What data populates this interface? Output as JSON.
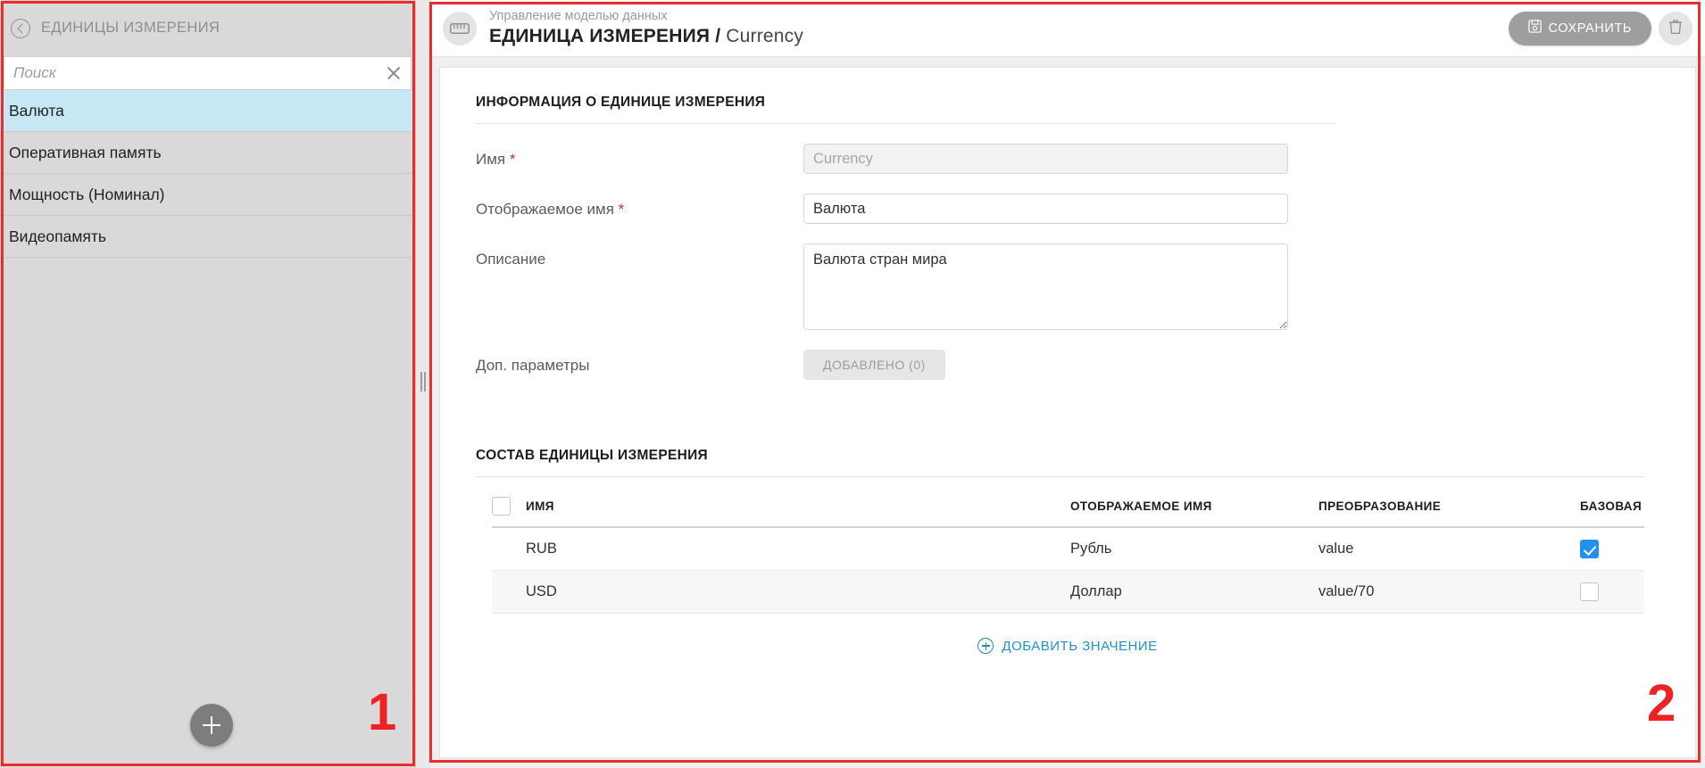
{
  "sidebar": {
    "title": "ЕДИНИЦЫ ИЗМЕРЕНИЯ",
    "collapse_icon": "chevron-left-circle-icon",
    "search": {
      "placeholder": "Поиск",
      "value": "",
      "clear_icon": "close-icon"
    },
    "items": [
      {
        "label": "Валюта",
        "selected": true
      },
      {
        "label": "Оперативная память",
        "selected": false
      },
      {
        "label": "Мощность (Номинал)",
        "selected": false
      },
      {
        "label": "Видеопамять",
        "selected": false
      }
    ],
    "add_button_icon": "plus-icon"
  },
  "splitter": {
    "grip_icon": "drag-handle-icon"
  },
  "header": {
    "avatar_icon": "ruler-icon",
    "breadcrumb": "Управление моделью данных",
    "title": "ЕДИНИЦА ИЗМЕРЕНИЯ",
    "separator": " / ",
    "object_name": "Currency",
    "save_label": "СОХРАНИТЬ",
    "save_icon": "save-floppy-icon",
    "delete_icon": "trash-icon"
  },
  "info_section": {
    "title": "ИНФОРМАЦИЯ О ЕДИНИЦЕ ИЗМЕРЕНИЯ",
    "fields": {
      "name_label": "Имя",
      "name_required": "*",
      "name_value": "Currency",
      "display_name_label": "Отображаемое имя",
      "display_name_required": "*",
      "display_name_value": "Валюта",
      "description_label": "Описание",
      "description_value": "Валюта стран мира",
      "extra_params_label": "Доп. параметры",
      "extra_params_button": "ДОБАВЛЕНО (0)"
    }
  },
  "composition_section": {
    "title": "СОСТАВ ЕДИНИЦЫ ИЗМЕРЕНИЯ",
    "columns": [
      "ИМЯ",
      "ОТОБРАЖАЕМОЕ ИМЯ",
      "ПРЕОБРАЗОВАНИЕ",
      "БАЗОВАЯ"
    ],
    "select_all_checked": false,
    "rows": [
      {
        "name": "RUB",
        "display_name": "Рубль",
        "conversion": "value",
        "base": true
      },
      {
        "name": "USD",
        "display_name": "Доллар",
        "conversion": "value/70",
        "base": false
      }
    ],
    "add_value_label": "ДОБАВИТЬ ЗНАЧЕНИЕ",
    "add_value_icon": "plus-circle-icon"
  },
  "annotations": [
    {
      "number": "1",
      "color": "#ee2222"
    },
    {
      "number": "2",
      "color": "#ee2222"
    }
  ],
  "colors": {
    "accent_blue": "#2091f0",
    "link_blue": "#1d8fd3",
    "selected_row": "#c8e7f5",
    "sidebar_bg": "#d9d9d9",
    "annotation_red": "#ee2a2a"
  }
}
